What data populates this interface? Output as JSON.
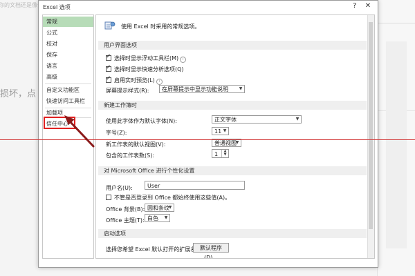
{
  "background": {
    "top_fragment": "你的文档还是像个...",
    "left_fragment": "损坏，点"
  },
  "dialog": {
    "title": "Excel 选项",
    "help_glyph": "?",
    "close_glyph": "✕"
  },
  "nav": {
    "items": [
      {
        "label": "常规",
        "selected": true
      },
      {
        "label": "公式"
      },
      {
        "label": "校对"
      },
      {
        "label": "保存"
      },
      {
        "label": "语言"
      },
      {
        "label": "高级"
      },
      {
        "label": "自定义功能区"
      },
      {
        "label": "快速访问工具栏"
      },
      {
        "label": "加载项"
      },
      {
        "label": "信任中心"
      }
    ]
  },
  "content": {
    "intro": "使用 Excel 时采用的常规选项。",
    "ui_section": {
      "header": "用户界面选项",
      "opt_mini_toolbar": "选择时显示浮动工具栏(M)",
      "opt_quick_analysis": "选择时显示快速分析选项(Q)",
      "opt_live_preview": "启用实时预览(L)",
      "tooltip_label": "屏幕提示样式(R):",
      "tooltip_value": "在屏幕提示中显示功能说明"
    },
    "new_wb_section": {
      "header": "新建工作簿时",
      "font_label": "使用此字体作为默认字体(N):",
      "font_value": "正文字体",
      "size_label": "字号(Z):",
      "size_value": "11",
      "view_label": "新工作表的默认视图(V):",
      "view_value": "普通视图",
      "sheets_label": "包含的工作表数(S):",
      "sheets_value": "1"
    },
    "personalize_section": {
      "header": "对 Microsoft Office 进行个性化设置",
      "username_label": "用户名(U):",
      "username_value": "User",
      "always_use_label": "不管是否登录到 Office 都始终使用这些值(A)。",
      "bg_label": "Office 背景(B):",
      "bg_value": "圆和条纹",
      "theme_label": "Office 主题(T):",
      "theme_value": "白色"
    },
    "startup_section": {
      "header": "启动选项",
      "ext_label": "选择您希望 Excel 默认打开的扩展名:",
      "default_programs_button": "默认程序(D)..."
    }
  },
  "colors": {
    "selected_nav": "#b7dcb8",
    "highlight_box": "#e02020",
    "annotation_arrow": "#8b1a1a",
    "guide_line": "#d23a3a"
  }
}
